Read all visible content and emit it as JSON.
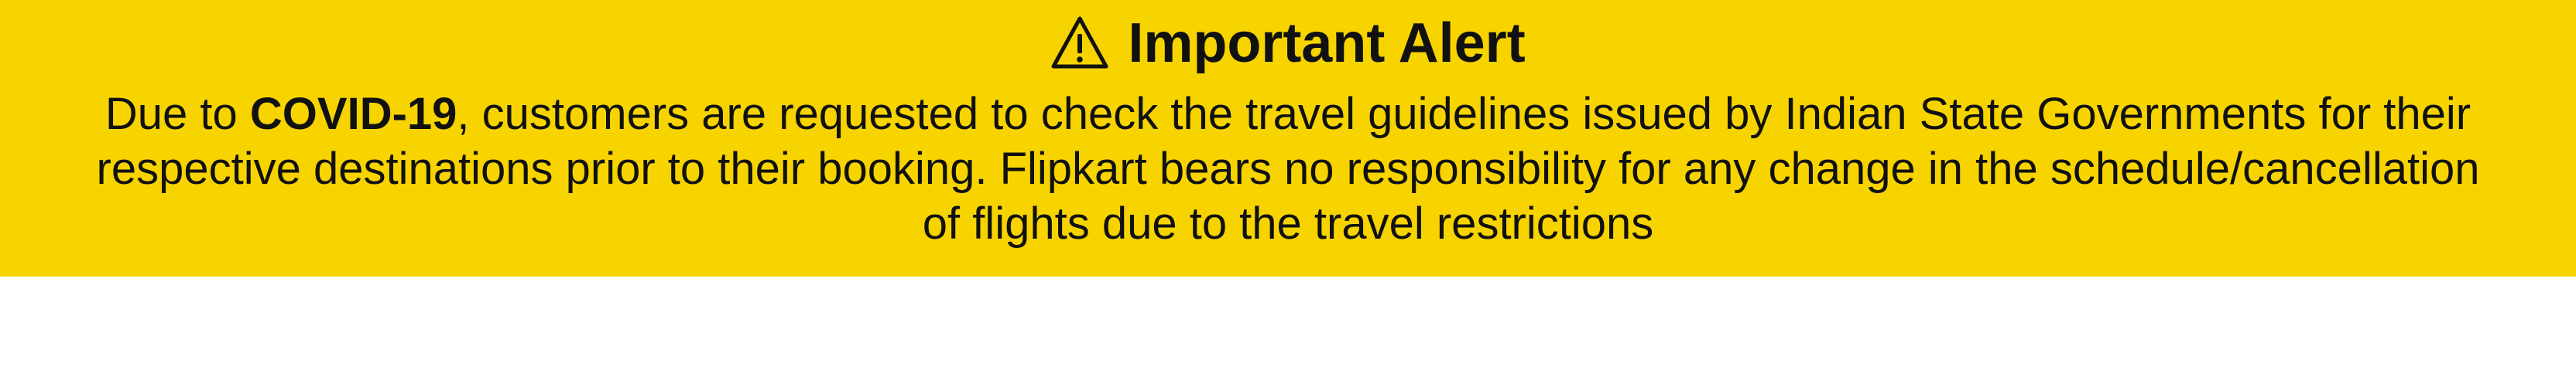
{
  "alert": {
    "icon": "warning-triangle-icon",
    "title": "Important Alert",
    "message": {
      "prefix": "Due to ",
      "highlight": "COVID-19",
      "suffix": ", customers are requested to check the travel guidelines issued by Indian State Governments for their respective destinations prior to their booking. Flipkart bears no responsibility for any change in the schedule/cancellation of flights due to the travel restrictions"
    },
    "background_color": "#f7d400",
    "text_color": "#111111"
  }
}
